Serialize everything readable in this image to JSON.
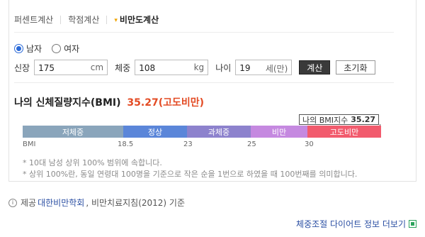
{
  "tabs": [
    {
      "label": "퍼센트계산",
      "active": false
    },
    {
      "label": "학점계산",
      "active": false
    },
    {
      "label": "비만도계산",
      "active": true
    }
  ],
  "gender": {
    "options": [
      "남자",
      "여자"
    ],
    "selected": "남자"
  },
  "inputs": {
    "height_label": "신장",
    "height_value": "175",
    "height_unit": "cm",
    "weight_label": "체중",
    "weight_value": "108",
    "weight_unit": "kg",
    "age_label": "나이",
    "age_value": "19",
    "age_unit": "세(만)",
    "calc_button": "계산",
    "reset_button": "초기화"
  },
  "result": {
    "title": "나의 신체질량지수(BMI)",
    "value": "35.27(고도비만)",
    "marker_label": "나의 BMI지수",
    "marker_value": "35.27",
    "marker_bmi": 35.27
  },
  "scale": {
    "segments": [
      "저체중",
      "정상",
      "과체중",
      "비만",
      "고도비만"
    ],
    "tick_label": "BMI",
    "ticks": [
      "18.5",
      "23",
      "25",
      "30"
    ],
    "colors": [
      "#8aa5bb",
      "#5b86d9",
      "#8d82cd",
      "#c589e0",
      "#f25b6d"
    ]
  },
  "notes": [
    "* 10대 남성 상위 100% 범위에 속합니다.",
    "* 상위 100%란, 동일 연령대 100명을 기준으로 작은 순을 1번으로 하였을 때 100번째를 의미합니다."
  ],
  "source": {
    "prefix": "제공",
    "link": "대한비만학회",
    "suffix": ", 비만치료지침(2012) 기준"
  },
  "more_link": "체중조절 다이어트 정보 더보기"
}
